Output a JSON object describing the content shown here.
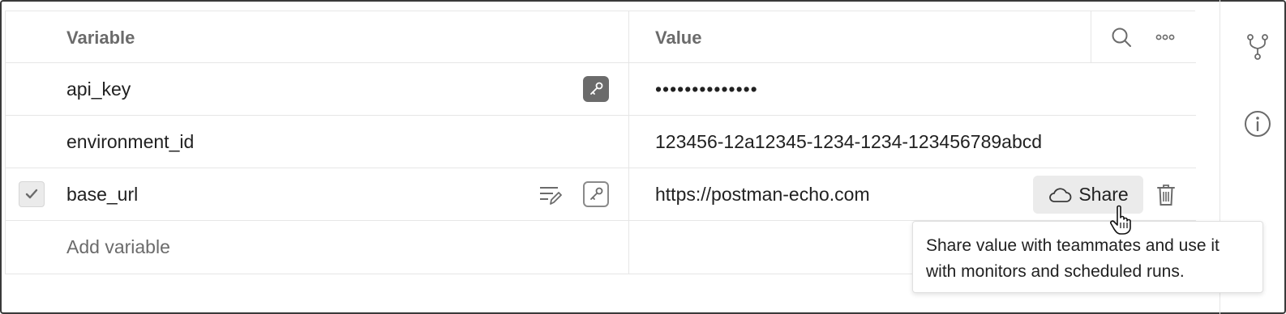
{
  "table": {
    "header": {
      "variable": "Variable",
      "value": "Value"
    },
    "rows": [
      {
        "name": "api_key",
        "value": "••••••••••••••",
        "checked": false,
        "secret": true
      },
      {
        "name": "environment_id",
        "value": "123456-12a12345-1234-1234-123456789abcd",
        "checked": false,
        "secret": false
      },
      {
        "name": "base_url",
        "value": "https://postman-echo.com",
        "checked": true,
        "secret": false
      }
    ],
    "add_placeholder": "Add variable"
  },
  "share": {
    "label": "Share",
    "tooltip": "Share value with teammates and use it with monitors and scheduled runs."
  },
  "icons": {
    "search": "search-icon",
    "more": "more-icon",
    "fork": "fork-icon",
    "info": "info-icon",
    "trash": "trash-icon",
    "cloud": "cloud-icon",
    "key": "key-icon",
    "edit": "edit-icon",
    "check": "check-icon",
    "cursor": "hand-cursor-icon"
  },
  "colors": {
    "border": "#e6e6e6",
    "muted_text": "#6b6b6b",
    "button_bg": "#ebebeb"
  }
}
